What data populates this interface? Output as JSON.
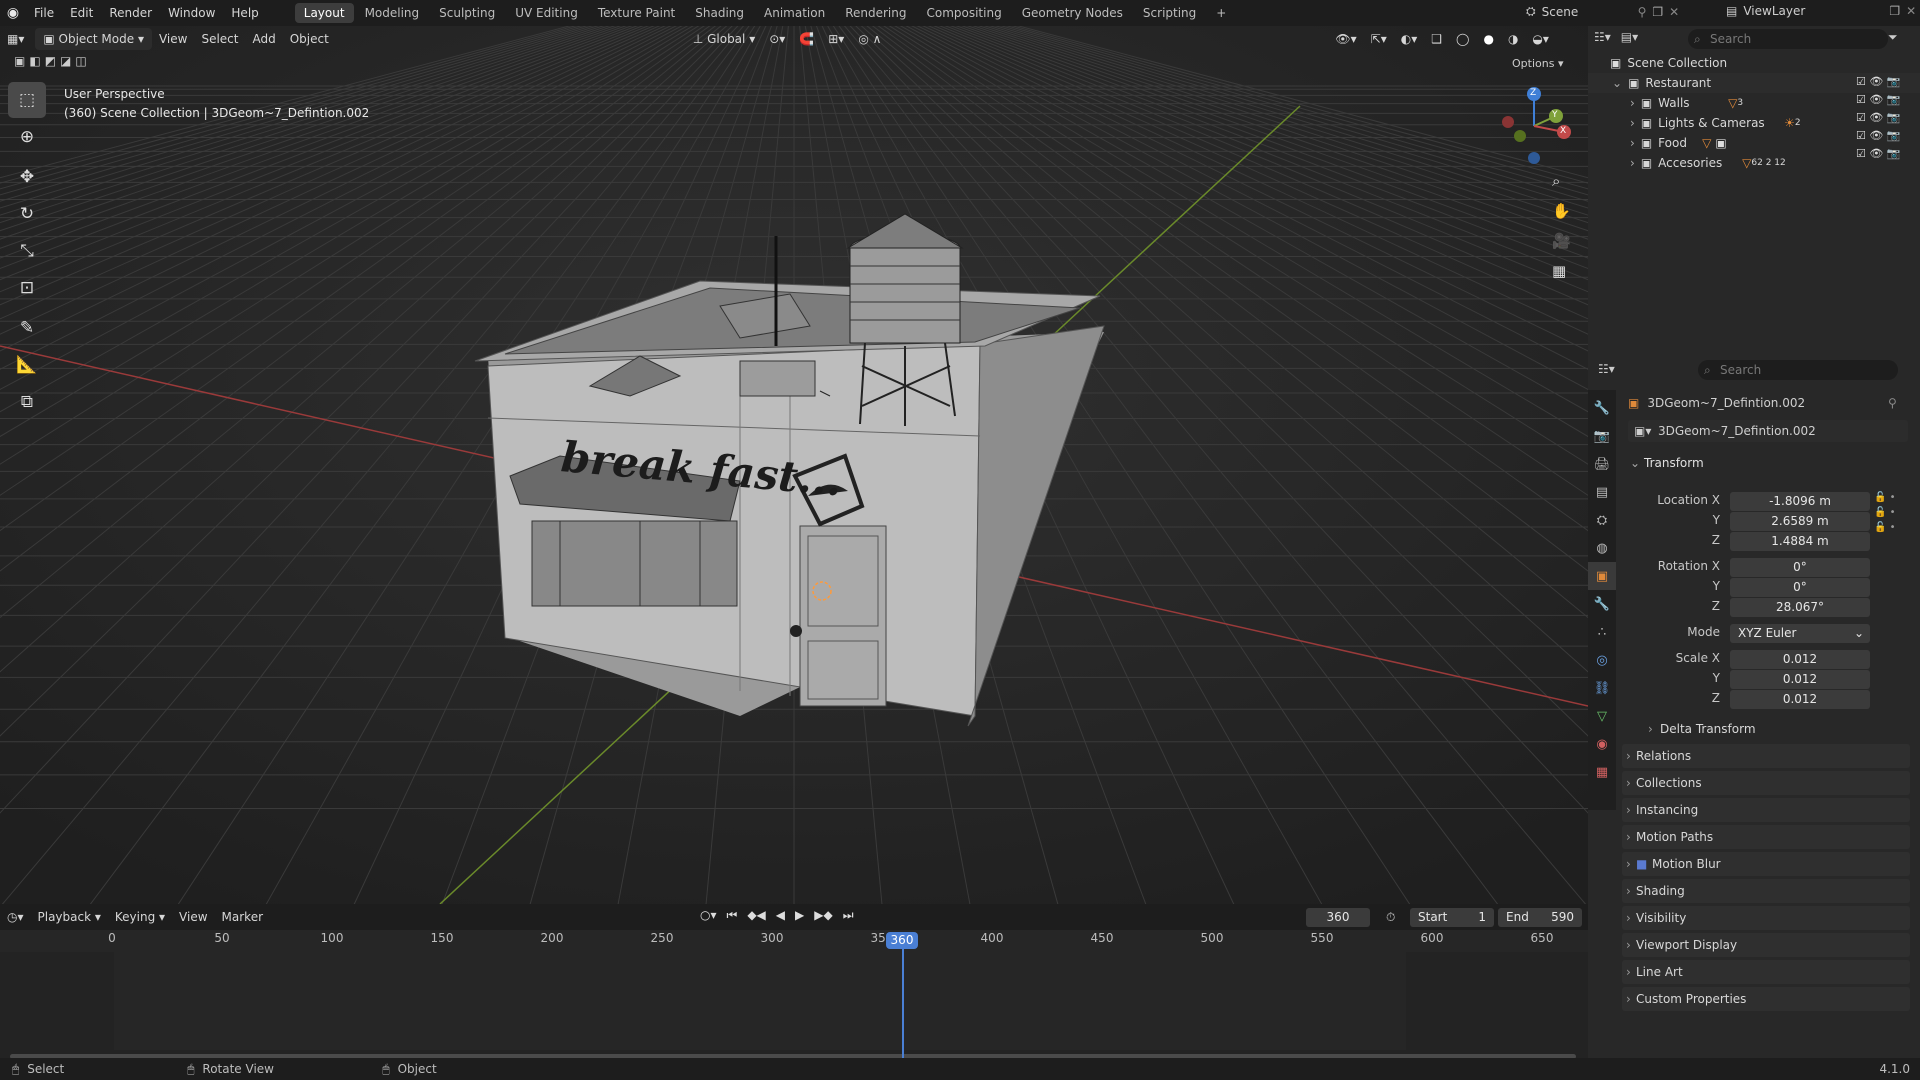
{
  "app": {
    "version": "4.1.0"
  },
  "topbar": {
    "menus": [
      "File",
      "Edit",
      "Render",
      "Window",
      "Help"
    ],
    "workspaces": [
      "Layout",
      "Modeling",
      "Sculpting",
      "UV Editing",
      "Texture Paint",
      "Shading",
      "Animation",
      "Rendering",
      "Compositing",
      "Geometry Nodes",
      "Scripting"
    ],
    "active_workspace": "Layout",
    "add_workspace": "+",
    "scene_label": "Scene",
    "view_layer_label": "ViewLayer"
  },
  "viewport": {
    "mode": "Object Mode",
    "menus": [
      "View",
      "Select",
      "Add",
      "Object"
    ],
    "transform_orientation": "Global",
    "options_label": "Options",
    "overlay_title": "User Perspective",
    "overlay_subtitle": "(360) Scene Collection | 3DGeom~7_Defintion.002",
    "gizmo_axes": {
      "x": "X",
      "y": "Y",
      "z": "Z"
    },
    "sign_text": "break fast...",
    "colors": {
      "x_axis": "#c24a4a",
      "y_axis": "#7fa13a",
      "z_axis": "#3f7fd6"
    }
  },
  "outliner": {
    "search_placeholder": "Search",
    "root": "Scene Collection",
    "items": [
      {
        "label": "Restaurant",
        "level": 0
      },
      {
        "label": "Walls",
        "level": 1,
        "badge": "3"
      },
      {
        "label": "Lights & Cameras",
        "level": 1,
        "badge": "2"
      },
      {
        "label": "Food",
        "level": 1,
        "badge": ""
      },
      {
        "label": "Accesories",
        "level": 1,
        "badge": "62 2 12"
      }
    ]
  },
  "properties": {
    "search_placeholder": "Search",
    "object_name": "3DGeom~7_Defintion.002",
    "data_name": "3DGeom~7_Defintion.002",
    "transform_title": "Transform",
    "location": {
      "label": "Location X",
      "x": "-1.8096 m",
      "y": "2.6589 m",
      "z": "1.4884 m"
    },
    "rotation": {
      "label": "Rotation X",
      "x": "0°",
      "y": "0°",
      "z": "28.067°"
    },
    "mode": {
      "label": "Mode",
      "value": "XYZ Euler"
    },
    "scale": {
      "label": "Scale X",
      "x": "0.012",
      "y": "0.012",
      "z": "0.012"
    },
    "axis_y": "Y",
    "axis_z": "Z",
    "delta_transform": "Delta Transform",
    "sections": [
      "Relations",
      "Collections",
      "Instancing",
      "Motion Paths",
      "Motion Blur",
      "Shading",
      "Visibility",
      "Viewport Display",
      "Line Art",
      "Custom Properties"
    ]
  },
  "timeline": {
    "menus": [
      "Playback",
      "Keying",
      "View",
      "Marker"
    ],
    "current_frame": "360",
    "start_label": "Start",
    "start": "1",
    "end_label": "End",
    "end": "590",
    "ruler": [
      "0",
      "50",
      "100",
      "150",
      "200",
      "250",
      "300",
      "350",
      "400",
      "450",
      "500",
      "550",
      "600",
      "650"
    ],
    "playhead": "360"
  },
  "statusbar": {
    "select": "Select",
    "rotate": "Rotate View",
    "object": "Object",
    "version": "4.1.0"
  }
}
